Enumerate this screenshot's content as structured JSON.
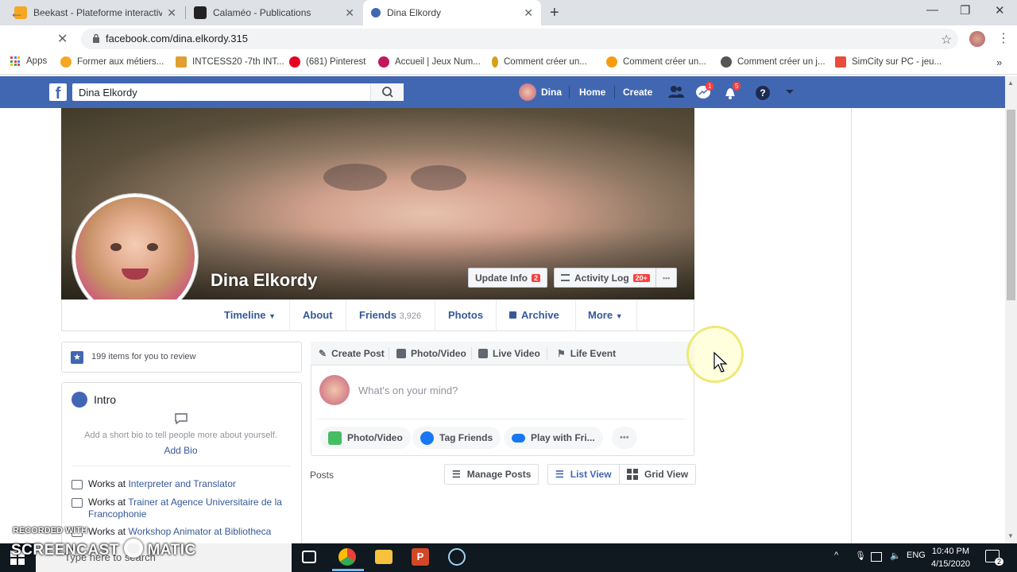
{
  "browser": {
    "tabs": [
      {
        "title": "Beekast - Plateforme interactive",
        "close": "✕"
      },
      {
        "title": "Calaméo - Publications",
        "close": "✕"
      },
      {
        "title": "Dina Elkordy",
        "close": "✕"
      }
    ],
    "new_tab": "+",
    "window": {
      "minimize": "—",
      "restore": "❐",
      "close": "✕"
    },
    "url": "facebook.com/dina.elkordy.315",
    "bookmarks": [
      {
        "label": "Apps",
        "color": "#e8453c"
      },
      {
        "label": "Former aux métiers...",
        "color": "#f5a623"
      },
      {
        "label": "INTCESS20 -7th INT...",
        "color": "#e0a030"
      },
      {
        "label": "(681) Pinterest",
        "color": "#e60023"
      },
      {
        "label": "Accueil | Jeux Num...",
        "color": "#c2185b"
      },
      {
        "label": "Comment créer un...",
        "color": "#d4a017"
      },
      {
        "label": "Comment créer un...",
        "color": "#f39c12"
      },
      {
        "label": "Comment créer un j...",
        "color": "#555555"
      },
      {
        "label": "SimCity sur PC - jeu...",
        "color": "#e74c3c"
      }
    ],
    "bookmarks_more": "»"
  },
  "facebook": {
    "logo": "f",
    "search_value": "Dina Elkordy",
    "nav": {
      "profile_name": "Dina",
      "home": "Home",
      "create": "Create"
    },
    "badges": {
      "messenger": "1",
      "notifications": "5"
    },
    "profile": {
      "name": "Dina Elkordy",
      "update_info": "Update Info",
      "update_info_badge": "2",
      "activity_log": "Activity Log",
      "activity_log_badge": "20+",
      "more_dots": "•••"
    },
    "timeline_tabs": {
      "timeline": "Timeline",
      "about": "About",
      "friends": "Friends",
      "friends_count": "3,926",
      "photos": "Photos",
      "archive": "Archive",
      "more": "More"
    },
    "review": "199 items for you to review",
    "intro": {
      "title": "Intro",
      "bio_prompt": "Add a short bio to tell people more about yourself.",
      "add_bio": "Add Bio",
      "works": [
        {
          "prefix": "Works at ",
          "place": "Interpreter and Translator"
        },
        {
          "prefix": "Works at ",
          "place": "Trainer at Agence Universitaire de la Francophonie"
        },
        {
          "prefix": "Works at ",
          "place": "Workshop Animator at Bibliotheca"
        }
      ]
    },
    "composer": {
      "tabs": [
        "Create Post",
        "Photo/Video",
        "Live Video",
        "Life Event"
      ],
      "placeholder": "What's on your mind?",
      "actions": [
        "Photo/Video",
        "Tag Friends",
        "Play with Fri..."
      ],
      "more": "•••"
    },
    "posts": {
      "label": "Posts",
      "manage": "Manage Posts",
      "list_view": "List View",
      "grid_view": "Grid View"
    }
  },
  "taskbar": {
    "search_placeholder": "Type here to search",
    "lang": "ENG",
    "time": "10:40 PM",
    "date": "4/15/2020",
    "notifications": "2"
  },
  "watermark": {
    "line1": "RECORDED WITH",
    "line2": "SCREENCAST",
    "line3": "MATIC"
  }
}
